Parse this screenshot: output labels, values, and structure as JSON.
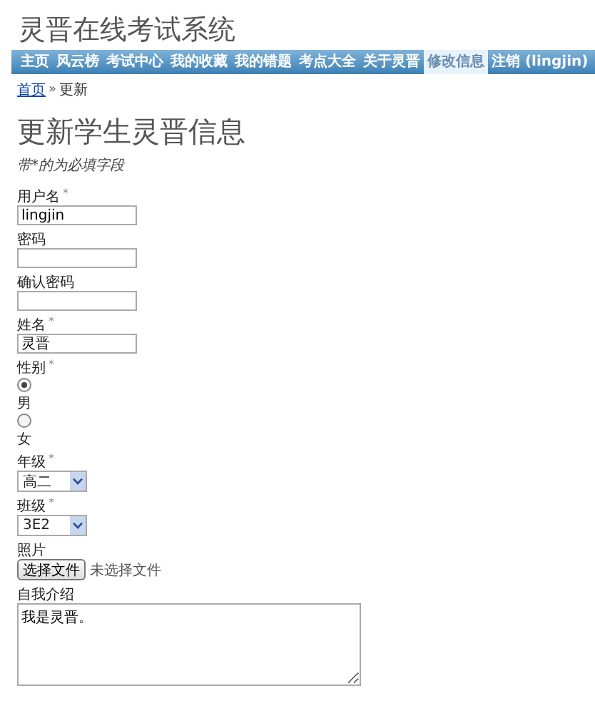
{
  "site_title": "灵晋在线考试系统",
  "nav": [
    {
      "label": "主页",
      "selected": false
    },
    {
      "label": "风云榜",
      "selected": false
    },
    {
      "label": "考试中心",
      "selected": false
    },
    {
      "label": "我的收藏",
      "selected": false
    },
    {
      "label": "我的错题",
      "selected": false
    },
    {
      "label": "考点大全",
      "selected": false
    },
    {
      "label": "关于灵晋",
      "selected": false
    },
    {
      "label": "修改信息",
      "selected": true
    },
    {
      "label": "注销 (lingjin)",
      "selected": false
    }
  ],
  "breadcrumb": {
    "link": "首页",
    "separator": "»",
    "current": "更新"
  },
  "heading": "更新学生灵晋信息",
  "note": "带*的为必填字段",
  "fields": [
    {
      "kind": "text",
      "label": "用户名",
      "mark": "*",
      "value": "lingjin"
    },
    {
      "kind": "password",
      "label": "密码"
    },
    {
      "kind": "password",
      "label": "确认密码"
    },
    {
      "kind": "text",
      "label": "姓名",
      "mark": "*",
      "value": "灵晋"
    },
    {
      "kind": "radio",
      "label": "性别",
      "mark": "*",
      "options": [
        {
          "label": "男",
          "selected": true
        },
        {
          "label": "女",
          "selected": false
        }
      ]
    },
    {
      "kind": "select",
      "label": "年级",
      "mark": "*",
      "value": "高二"
    },
    {
      "kind": "select",
      "label": "班级",
      "mark": "*",
      "value": "3E2"
    },
    {
      "kind": "file",
      "label": "照片",
      "button": "选择文件",
      "status": "未选择文件"
    },
    {
      "kind": "textarea",
      "label": "自我介绍",
      "value": "我是灵晋。"
    }
  ]
}
